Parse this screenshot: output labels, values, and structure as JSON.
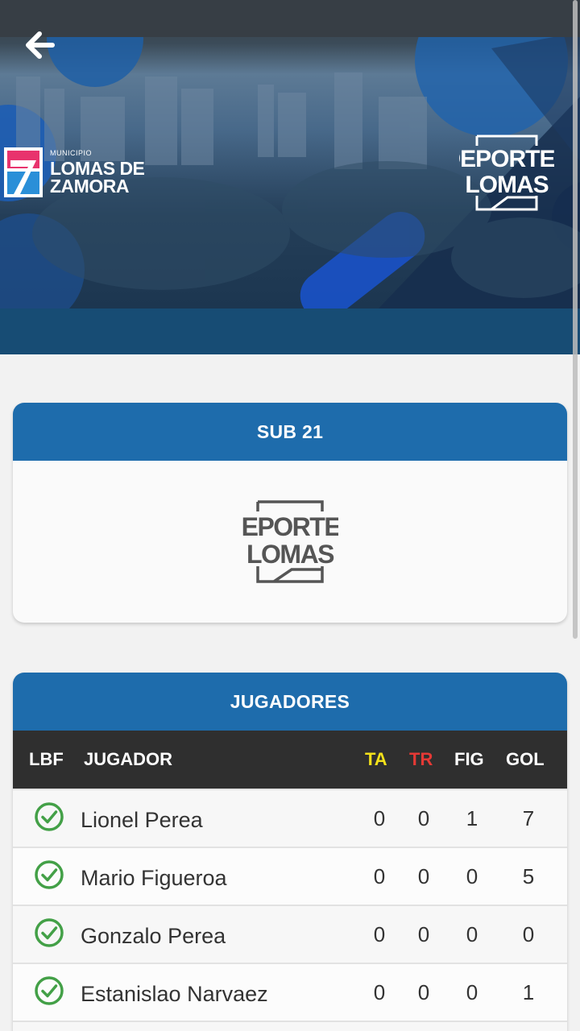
{
  "hero": {
    "municipio_label": "MUNICIPIO",
    "lomas_line1": "LOMAS DE",
    "lomas_line2": "ZAMORA",
    "deportes_line1": "DEPORTES",
    "deportes_line2": "LOMAS"
  },
  "category_card": {
    "title": "SUB 21",
    "logo_line1": "DEPORTES",
    "logo_line2": "LOMAS"
  },
  "players_card": {
    "title": "JUGADORES",
    "columns": {
      "lbf": "LBF",
      "player": "JUGADOR",
      "ta": "TA",
      "tr": "TR",
      "fig": "FIG",
      "gol": "GOL"
    },
    "rows": [
      {
        "name": "Lionel Perea",
        "ta": "0",
        "tr": "0",
        "fig": "1",
        "gol": "7"
      },
      {
        "name": "Mario Figueroa",
        "ta": "0",
        "tr": "0",
        "fig": "0",
        "gol": "5"
      },
      {
        "name": "Gonzalo Perea",
        "ta": "0",
        "tr": "0",
        "fig": "0",
        "gol": "0"
      },
      {
        "name": "Estanislao Narvaez",
        "ta": "0",
        "tr": "0",
        "fig": "0",
        "gol": "1"
      }
    ]
  },
  "colors": {
    "header_blue": "#1e6cac",
    "table_head": "#2f2f2f",
    "ta_yellow": "#f3e11a",
    "tr_red": "#e53935",
    "check_green": "#43a047"
  },
  "icons": {
    "back": "arrow-left-icon",
    "lbf_status": "check-circle-icon"
  }
}
